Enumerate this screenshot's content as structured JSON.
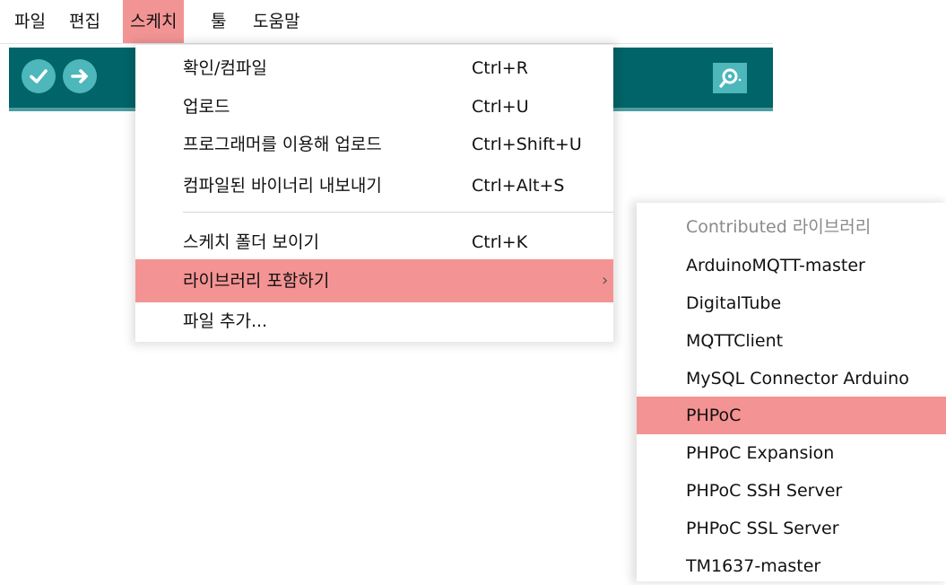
{
  "menubar": {
    "items": [
      {
        "label": "파일",
        "active": false
      },
      {
        "label": "편집",
        "active": false
      },
      {
        "label": "스케치",
        "active": true
      },
      {
        "label": "툴",
        "active": false
      },
      {
        "label": "도움말",
        "active": false
      }
    ]
  },
  "toolbar": {
    "background": "#006468",
    "button_color": "#4db7bb",
    "verify_icon": "checkmark-icon",
    "upload_icon": "arrow-right-icon",
    "serial_icon": "magnifier-icon"
  },
  "sketch_menu": {
    "items": [
      {
        "label": "확인/컴파일",
        "shortcut": "Ctrl+R"
      },
      {
        "label": "업로드",
        "shortcut": "Ctrl+U"
      },
      {
        "label": "프로그래머를 이용해 업로드",
        "shortcut": "Ctrl+Shift+U"
      },
      {
        "label": "컴파일된 바이너리 내보내기",
        "shortcut": "Ctrl+Alt+S"
      },
      {
        "label": "스케치 폴더 보이기",
        "shortcut": "Ctrl+K"
      },
      {
        "label": "라이브러리 포함하기",
        "shortcut": "",
        "submenu_arrow": "›",
        "highlighted": true
      },
      {
        "label": "파일 추가...",
        "shortcut": ""
      }
    ]
  },
  "library_submenu": {
    "header": "Contributed 라이브러리",
    "items": [
      {
        "label": "ArduinoMQTT-master"
      },
      {
        "label": "DigitalTube"
      },
      {
        "label": "MQTTClient"
      },
      {
        "label": "MySQL Connector Arduino"
      },
      {
        "label": "PHPoC",
        "highlighted": true
      },
      {
        "label": "PHPoC Expansion"
      },
      {
        "label": "PHPoC SSH Server"
      },
      {
        "label": "PHPoC SSL Server"
      },
      {
        "label": "TM1637-master"
      }
    ]
  },
  "colors": {
    "highlight": "#f49393",
    "menubar_active": "#f39494"
  }
}
